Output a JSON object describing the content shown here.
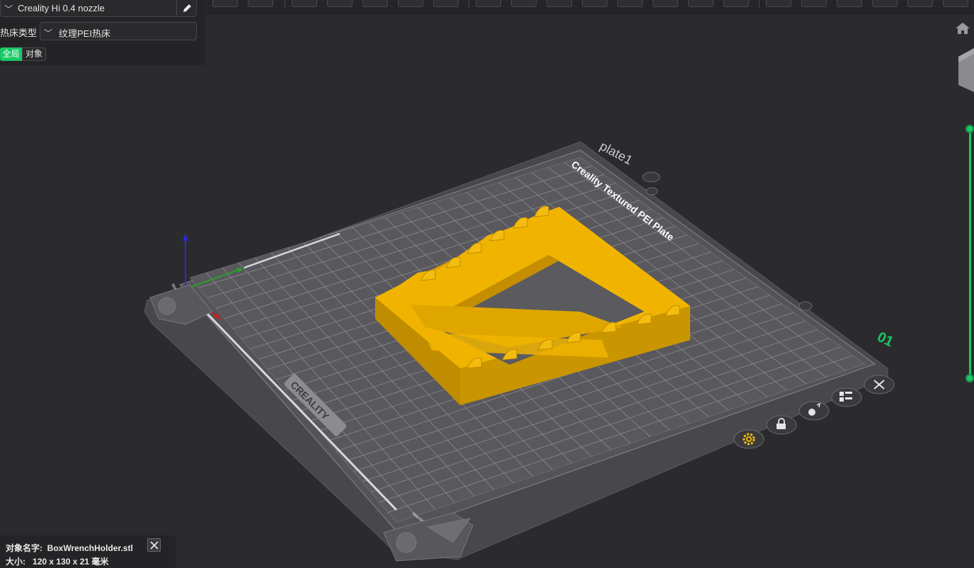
{
  "printer": {
    "name": "Creality Hi 0.4 nozzle"
  },
  "bed_type": {
    "label": "热床类型",
    "value": "纹理PEI热床"
  },
  "scope_tabs": {
    "global": "全局",
    "object": "对象"
  },
  "plate": {
    "name": "plate1",
    "brand_text": "Creality Textured PEI Plate",
    "logo_text": "CREALITY",
    "warning_text": "Warning hot surface",
    "number": "01"
  },
  "object_info": {
    "name_label": "对象名字:",
    "name_value": "BoxWrenchHolder.stl",
    "size_label": "大小:",
    "size_value": "120 x 130 x 21 毫米"
  },
  "colors": {
    "accent": "#17c964",
    "model": "#f0b400",
    "background": "#2b2b2e",
    "plate": "#4a4a4e"
  },
  "icons": [
    "chevron-down-icon",
    "pencil-icon",
    "home-icon",
    "gear-icon",
    "lock-icon",
    "auto-orient-icon",
    "arrange-icon",
    "close-icon"
  ]
}
